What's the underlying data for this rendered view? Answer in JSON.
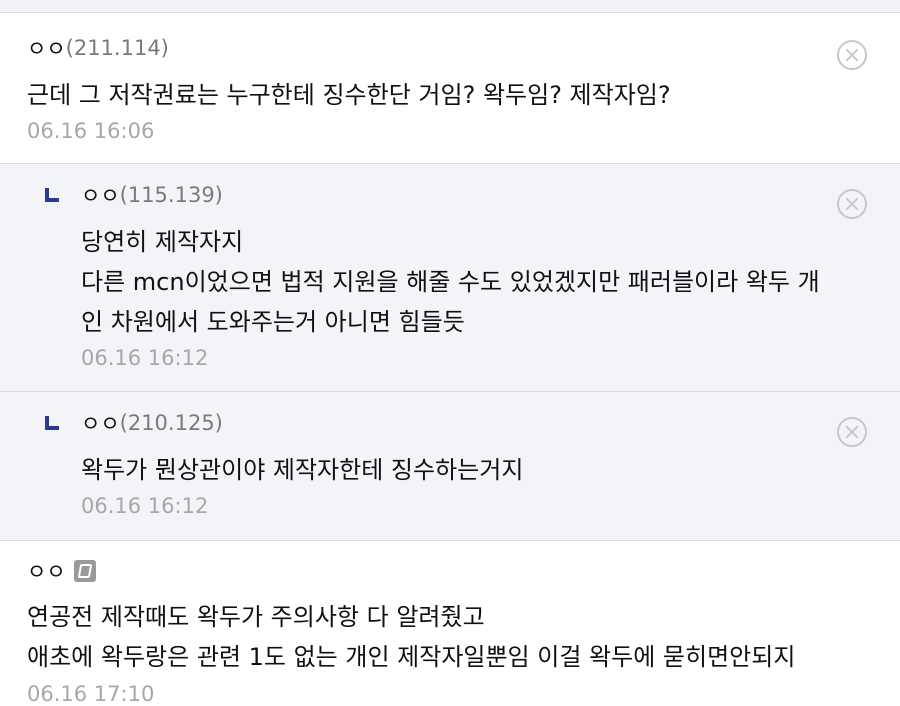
{
  "comments": [
    {
      "author": "ㅇㅇ",
      "ip": "(211.114)",
      "text": "근데 그 저작권료는 누구한테 징수한단 거임? 왁두임? 제작자임?",
      "time": "06.16 16:06"
    },
    {
      "author": "ㅇㅇ",
      "ip": "(115.139)",
      "text": "당연히 제작자지\n다른 mcn이었으면 법적 지원을 해줄 수도 있었겠지만 패러블이라 왁두 개\n인 차원에서 도와주는거 아니면 힘들듯",
      "time": "06.16 16:12"
    },
    {
      "author": "ㅇㅇ",
      "ip": "(210.125)",
      "text": "왁두가 뭔상관이야 제작자한테 징수하는거지",
      "time": "06.16 16:12"
    },
    {
      "author": "ㅇㅇ",
      "text": "연공전 제작때도 왁두가 주의사항 다 알려줬고\n애초에 왁두랑은 관련 1도 없는 개인 제작자일뿐임 이걸 왁두에 묻히면안되지",
      "time": "06.16 17:10",
      "icon": "mobile-icon"
    }
  ]
}
